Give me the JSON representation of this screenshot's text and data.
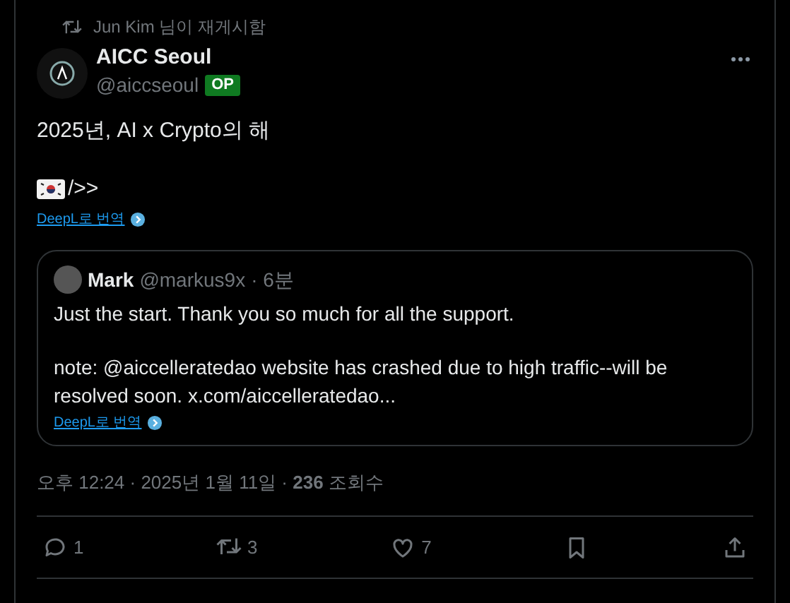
{
  "repost_label": "Jun Kim 님이 재게시함",
  "author": {
    "name": "AICC Seoul",
    "handle": "@aiccseoul",
    "badge": "OP"
  },
  "post": {
    "text": "2025년, AI x Crypto의 해",
    "suffix": "/>>",
    "translate": "DeepL로 번역"
  },
  "quote": {
    "name": "Mark",
    "handle": "@markus9x",
    "time": "· 6분",
    "paragraphs": [
      "Just the start. Thank you so much for all the support.",
      "note: @aiccelleratedao website has crashed due to high traffic--will be resolved soon. x.com/aiccelleratedao..."
    ],
    "translate": "DeepL로 번역"
  },
  "meta": "오후 12:24 · 2025년 1월 11일 · **236** 조회수",
  "actions": [
    {
      "kind": "reply",
      "count": "1"
    },
    {
      "kind": "repost",
      "count": "3"
    },
    {
      "kind": "like",
      "count": "7"
    },
    {
      "kind": "bookmark"
    },
    {
      "kind": "share"
    }
  ]
}
